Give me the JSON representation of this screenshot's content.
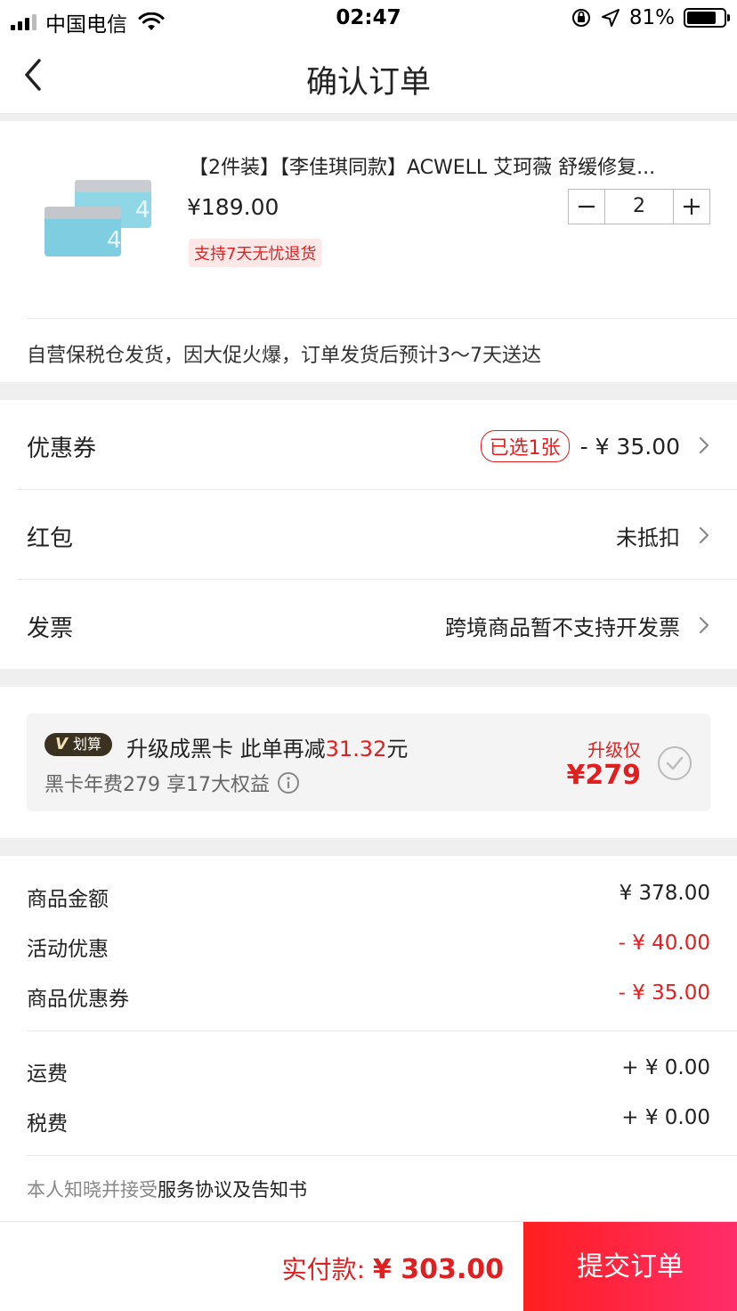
{
  "status_bar": {
    "carrier": "中国电信",
    "time": "02:47",
    "battery": "81%",
    "battery_level": 0.81
  },
  "nav": {
    "title": "确认订单",
    "back_icon": "chevron-left-icon"
  },
  "product": {
    "title": "【2件装】【李佳琪同款】ACWELL 艾珂薇 舒缓修复...",
    "price": "¥189.00",
    "quantity": "2",
    "tag": "支持7天无忧退货",
    "shipping_note": "自营保税仓发货，因大促火爆，订单发货后预计3～7天送达"
  },
  "options": {
    "coupon": {
      "label": "优惠券",
      "badge": "已选1张",
      "value": "- ¥ 35.00"
    },
    "red_packet": {
      "label": "红包",
      "value": "未抵扣"
    },
    "invoice": {
      "label": "发票",
      "value": "跨境商品暂不支持开发票"
    }
  },
  "upsell": {
    "tag_v": "V",
    "tag_text": "划算",
    "main_prefix": "升级成黑卡 此单再减",
    "main_amount": "31.32",
    "main_suffix": "元",
    "sub": "黑卡年费279 享17大权益",
    "price_label": "升级仅",
    "price": "¥279"
  },
  "summary": {
    "lines": [
      {
        "label": "商品金额",
        "value": "¥ 378.00"
      },
      {
        "label": "活动优惠",
        "value": "- ¥ 40.00"
      },
      {
        "label": "商品优惠券",
        "value": "- ¥ 35.00"
      },
      {
        "label": "运费",
        "value": "+ ¥ 0.00"
      },
      {
        "label": "税费",
        "value": "+ ¥ 0.00"
      }
    ],
    "agree_prefix": "本人知晓并接受",
    "agree_link": "服务协议及告知书"
  },
  "footer": {
    "pay_label": "实付款:",
    "pay_amount": "¥ 303.00",
    "submit_label": "提交订单"
  },
  "colors": {
    "accent_red": "#e02020",
    "submit_gradient_start": "#ff1f1f",
    "submit_gradient_end": "#ff2d6a",
    "section_gap": "#efefef"
  }
}
